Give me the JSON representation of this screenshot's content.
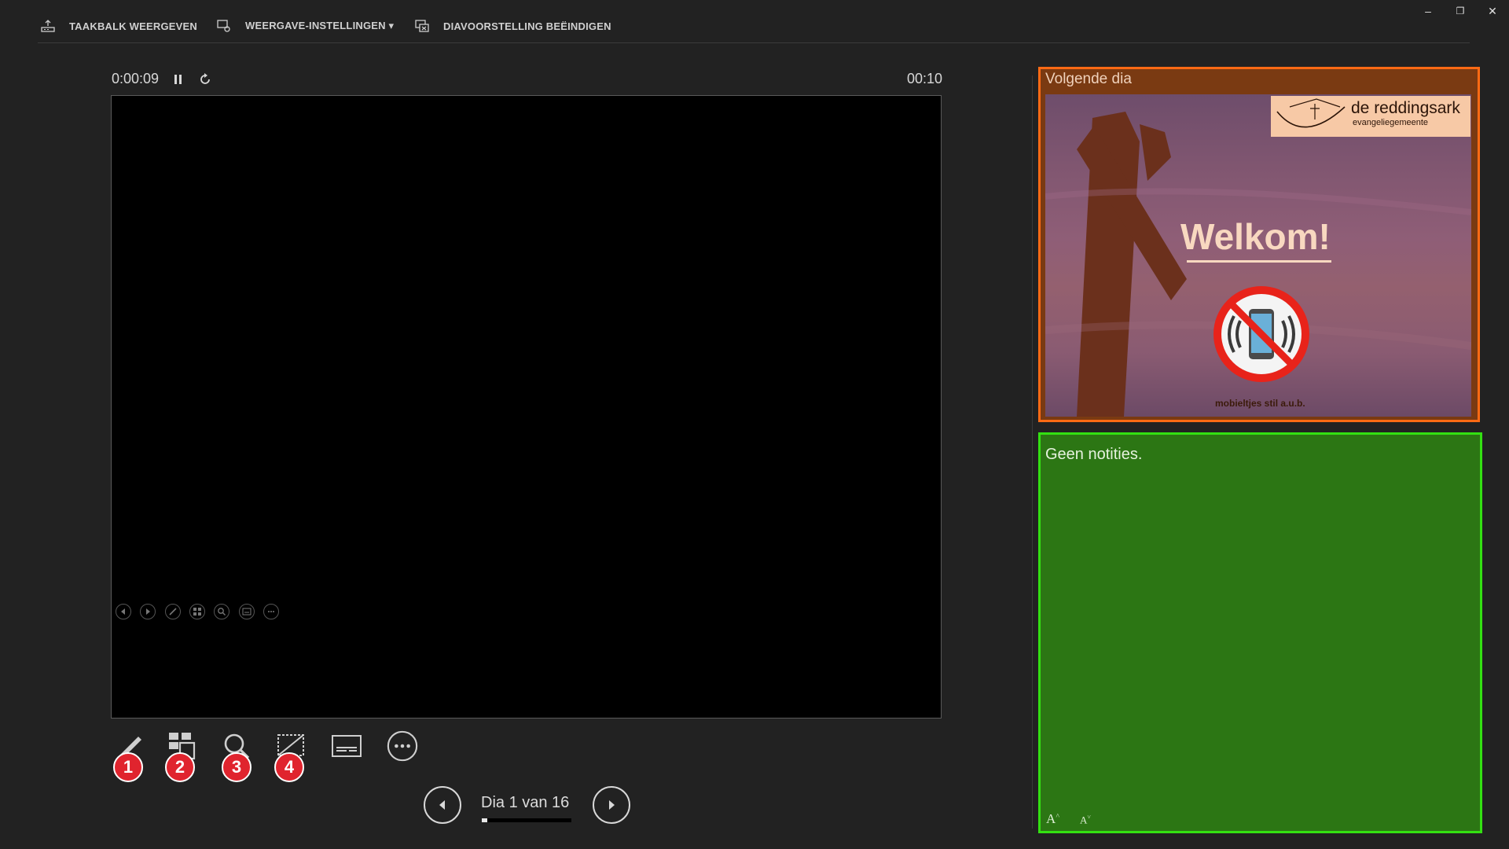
{
  "toolbar": {
    "show_taskbar": "TAAKBALK WEERGEVEN",
    "display_settings": "WEERGAVE-INSTELLINGEN",
    "end_slideshow": "DIAVOORSTELLING BEËINDIGEN"
  },
  "window_controls": {
    "minimize": "–",
    "restore": "❐",
    "close": "✕"
  },
  "timer": {
    "elapsed": "0:00:09",
    "clock": "00:10"
  },
  "tool_badges": [
    "1",
    "2",
    "3",
    "4"
  ],
  "navigation": {
    "slide_counter": "Dia 1 van 16",
    "current": 1,
    "total": 16
  },
  "next_slide": {
    "label": "Volgende dia",
    "logo_title": "de reddingsark",
    "logo_subtitle": "evangeliegemeente",
    "heading": "Welkom!",
    "caption": "mobieltjes stil a.u.b."
  },
  "notes": {
    "text": "Geen notities.",
    "increase_font": "A",
    "decrease_font": "A"
  },
  "colors": {
    "next_border": "#ff6a14",
    "notes_border": "#33e012",
    "badge": "#e0242e"
  }
}
